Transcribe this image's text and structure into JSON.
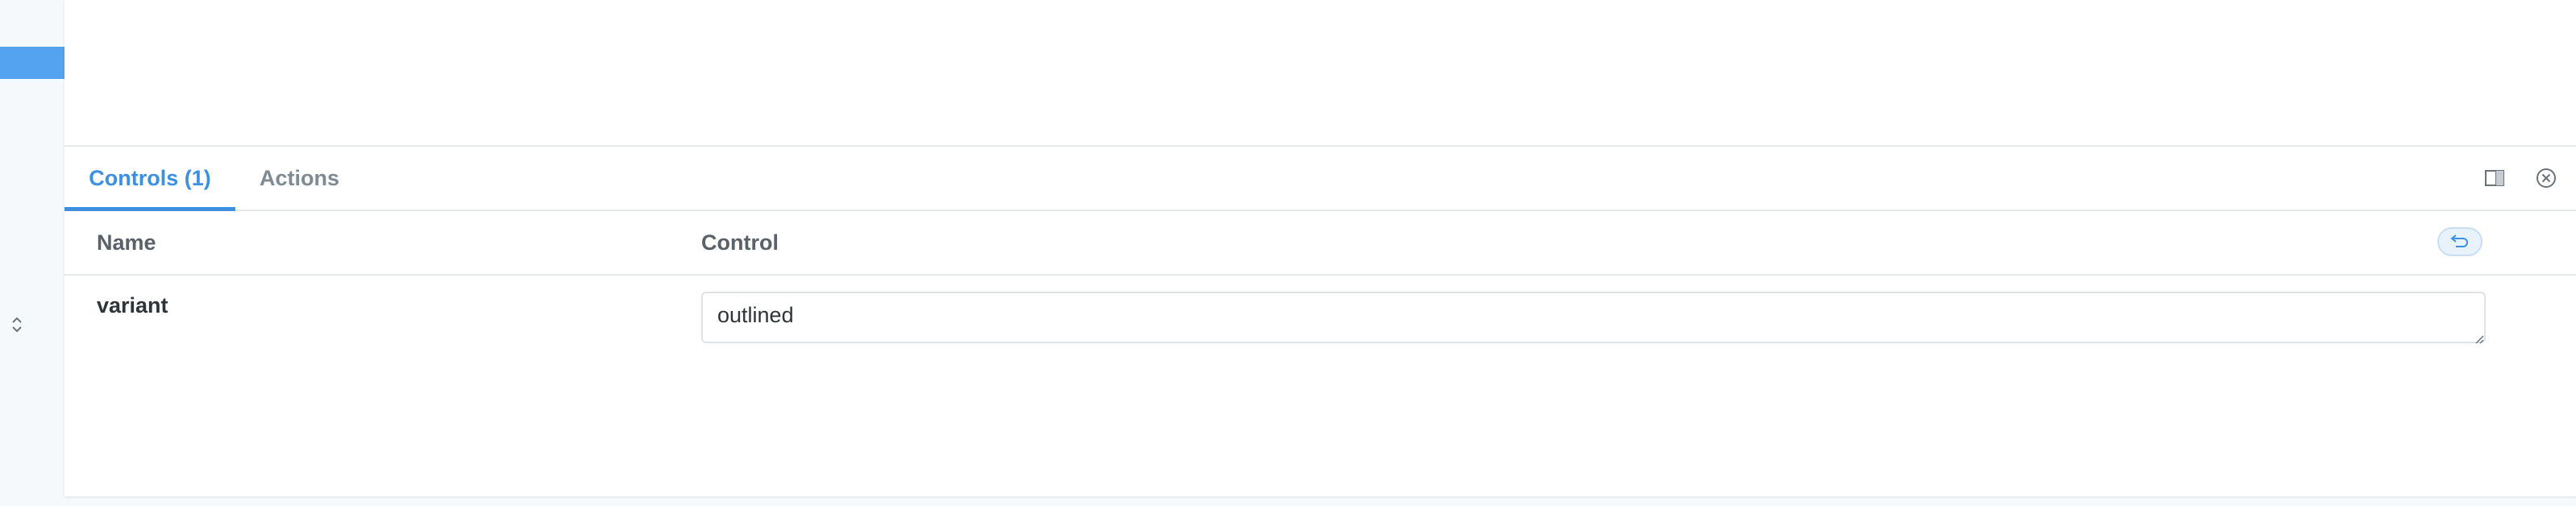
{
  "sidebar": {
    "chevron_icon": "chevron-up-down-icon",
    "active_color": "#54a3f0"
  },
  "addons": {
    "tabs": [
      {
        "label": "Controls (1)",
        "active": true
      },
      {
        "label": "Actions",
        "active": false
      }
    ],
    "toolbar": {
      "panel_icon": "panel-layout-icon",
      "close_icon": "close-circle-icon"
    }
  },
  "controls_table": {
    "headers": {
      "name": "Name",
      "control": "Control"
    },
    "reset_icon": "undo-icon",
    "rows": [
      {
        "name": "variant",
        "value": "outlined"
      }
    ]
  },
  "colors": {
    "accent": "#3d8fe0",
    "muted_text": "#808a92",
    "border": "#e6e9ec"
  }
}
